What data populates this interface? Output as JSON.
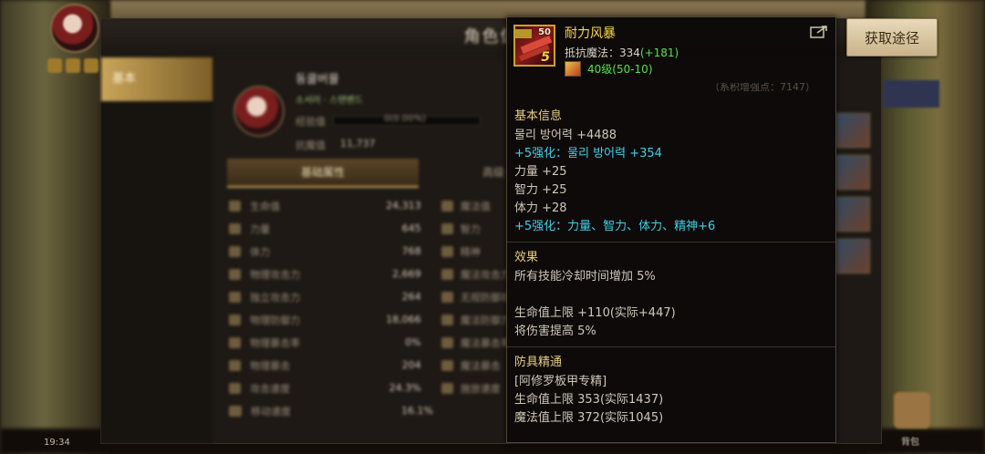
{
  "character_window": {
    "title": "角色信",
    "side_tab": "基本",
    "character_name": "동쿨버뮬",
    "subtitle": "소서러 · 스탠벤드",
    "exp_label": "经验值",
    "exp_value": "0(0.00%)",
    "exp_progress": 0.0,
    "magic_resist_label": "抗魔值",
    "magic_resist_value": "11,737",
    "tabs": [
      "基础属性",
      "高级"
    ],
    "stats": [
      {
        "name": "生命值",
        "value": "24,313",
        "right": "魔法值"
      },
      {
        "name": "力量",
        "value": "645",
        "right": "智力"
      },
      {
        "name": "体力",
        "value": "768",
        "right": "精神"
      },
      {
        "name": "物理攻击力",
        "value": "2,669",
        "right": "魔法攻击力"
      },
      {
        "name": "独立攻击力",
        "value": "264",
        "right": "无视防御攻击"
      },
      {
        "name": "物理防御力",
        "value": "18,066",
        "right": "魔法防御力"
      },
      {
        "name": "物理暴击率",
        "value": "0%",
        "right": "魔法暴击率"
      },
      {
        "name": "物理暴击",
        "value": "204",
        "right": "魔法暴击"
      },
      {
        "name": "攻击速度",
        "value": "24.3%",
        "right": "施放速度"
      },
      {
        "name": "移动速度",
        "value": "16.1%",
        "right": ""
      }
    ]
  },
  "hud": {
    "time": "19:34"
  },
  "tooltip": {
    "item_name": "耐力风暴",
    "item_level_badge": "50",
    "enhance_badge": "5",
    "resist_label": "抵抗魔法：334",
    "resist_bonus": "(+181)",
    "level_text": "40级(50-10)",
    "faint_text": "（系积增强点：7147）",
    "sections": [
      {
        "title": "基本信息",
        "lines": [
          {
            "text": "물리 방어력 +4488",
            "style": "normal"
          },
          {
            "text": "+5强化：물리 방어력 +354",
            "style": "cyan"
          },
          {
            "text": "力量 +25",
            "style": "normal"
          },
          {
            "text": "智力 +25",
            "style": "normal"
          },
          {
            "text": "体力 +28",
            "style": "normal"
          },
          {
            "text": "+5强化：力量、智力、体力、精神+6",
            "style": "cyan"
          }
        ]
      },
      {
        "title": "效果",
        "lines": [
          {
            "text": "所有技能冷却时间增加 5%",
            "style": "normal"
          },
          {
            "text": "",
            "style": "spacer"
          },
          {
            "text": "生命值上限 +110(实际+447)",
            "style": "normal"
          },
          {
            "text": "将伤害提高 5%",
            "style": "normal"
          }
        ]
      },
      {
        "title": "防具精通",
        "lines": [
          {
            "text": "[阿修罗板甲专精]",
            "style": "normal"
          },
          {
            "text": "生命值上限 353(实际1437)",
            "style": "normal"
          },
          {
            "text": "魔法值上限 372(实际1045)",
            "style": "normal"
          }
        ]
      }
    ]
  },
  "source_button": "获取途径",
  "right_label": "背包",
  "colors": {
    "gold": "#ffd44a",
    "green": "#58e04a",
    "cyan": "#3fd1e8",
    "section": "#e8cd7e"
  }
}
